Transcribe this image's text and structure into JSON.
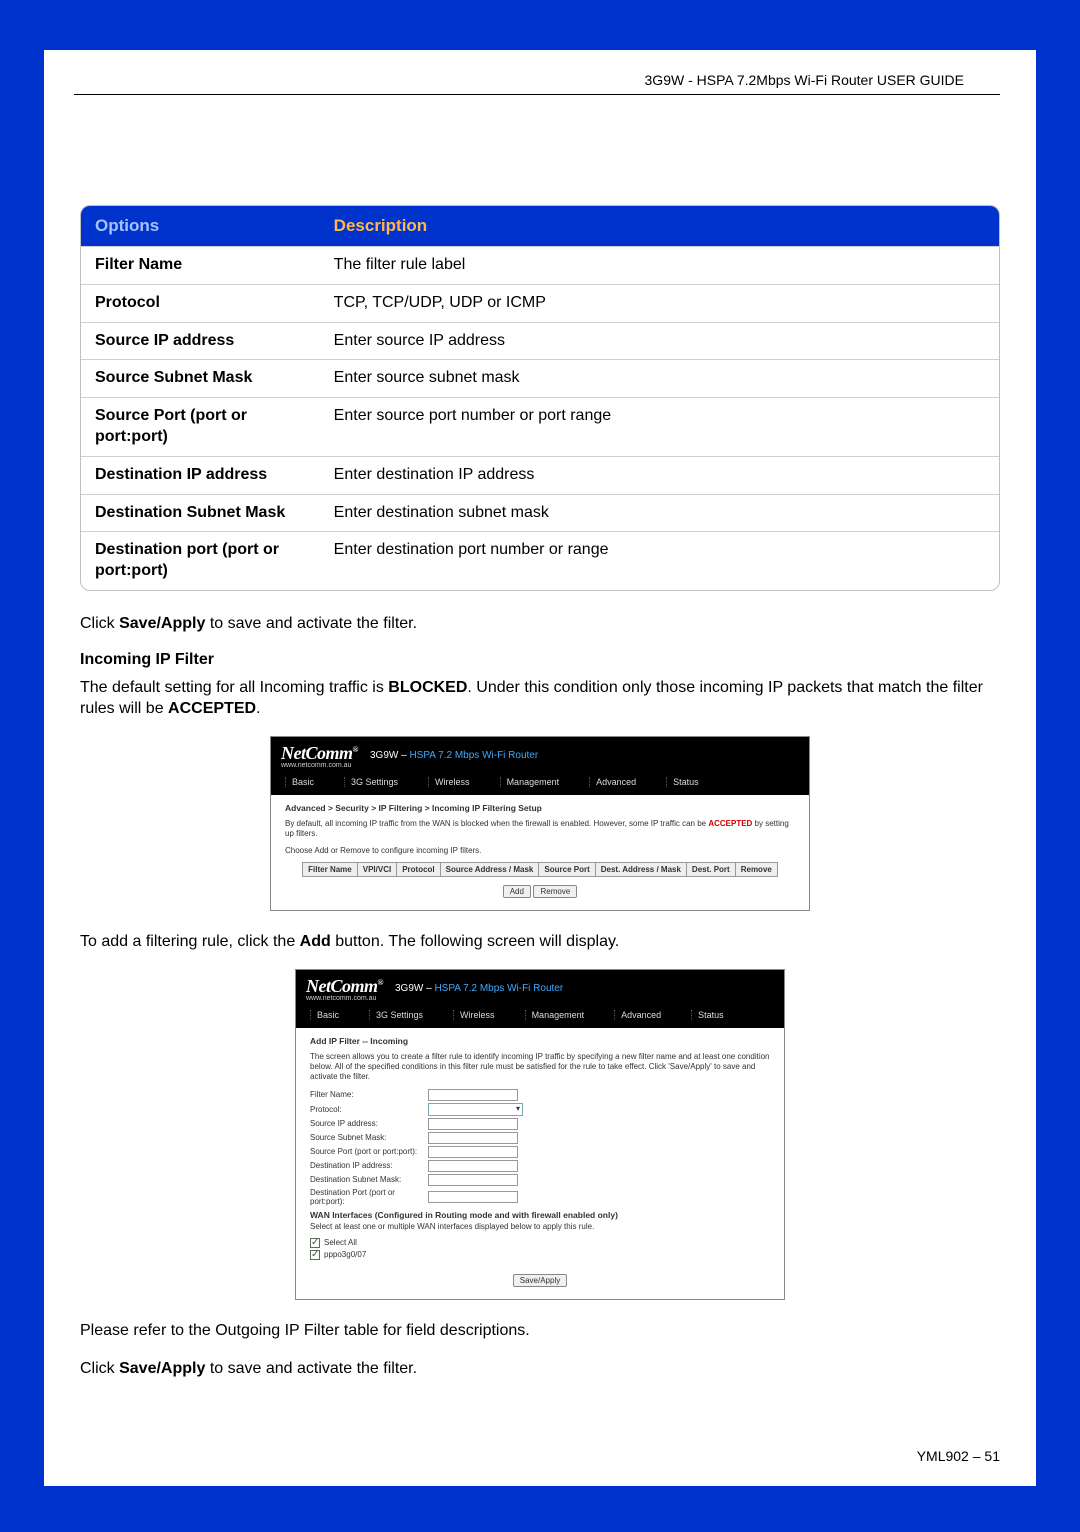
{
  "header": "3G9W - HSPA 7.2Mbps Wi-Fi Router USER GUIDE",
  "table": {
    "head_options": "Options",
    "head_description": "Description",
    "rows": [
      {
        "opt": "Filter Name",
        "desc": "The filter rule label"
      },
      {
        "opt": "Protocol",
        "desc": "TCP, TCP/UDP, UDP or ICMP"
      },
      {
        "opt": "Source IP address",
        "desc": "Enter source IP address"
      },
      {
        "opt": "Source Subnet Mask",
        "desc": "Enter source subnet mask"
      },
      {
        "opt": "Source Port (port or port:port)",
        "desc": "Enter source port number or port range"
      },
      {
        "opt": "Destination IP address",
        "desc": "Enter destination IP address"
      },
      {
        "opt": "Destination Subnet Mask",
        "desc": "Enter destination subnet mask"
      },
      {
        "opt": "Destination port (port or port:port)",
        "desc": "Enter destination port number or range"
      }
    ]
  },
  "para1_pre": "Click ",
  "para1_bold": "Save/Apply",
  "para1_post": " to save and activate the filter.",
  "heading_incoming": "Incoming IP Filter",
  "para2_pre": "The default setting for all Incoming traffic is ",
  "para2_b1": "BLOCKED",
  "para2_mid": ".  Under this condition only those incoming IP packets that match the filter rules will be ",
  "para2_b2": "ACCEPTED",
  "para2_post": ".",
  "shot1": {
    "logo": "NetComm",
    "logo_sub": "www.netcomm.com.au",
    "title_prefix": "3G9W – ",
    "title_hl": "HSPA 7.2 Mbps Wi-Fi Router",
    "nav": [
      "Basic",
      "3G Settings",
      "Wireless",
      "Management",
      "Advanced",
      "Status"
    ],
    "crumb": "Advanced > Security > IP Filtering > Incoming IP Filtering Setup",
    "line1_pre": "By default, all incoming IP traffic from the WAN is blocked when the firewall is enabled. However, some IP traffic can be ",
    "line1_acc": "ACCEPTED",
    "line1_post": " by setting up filters.",
    "line2": "Choose Add or Remove to configure incoming IP filters.",
    "cols": [
      "Filter Name",
      "VPI/VCI",
      "Protocol",
      "Source Address / Mask",
      "Source Port",
      "Dest. Address / Mask",
      "Dest. Port",
      "Remove"
    ],
    "btn_add": "Add",
    "btn_remove": "Remove"
  },
  "para3_pre": "To add a filtering rule, click the ",
  "para3_bold": "Add",
  "para3_post": " button. The following screen will display.",
  "shot2": {
    "crumb": "Add IP Filter -- Incoming",
    "desc": "The screen allows you to create a filter rule to identify incoming IP traffic by specifying a new filter name and at least one condition below. All of the specified conditions in this filter rule must be satisfied for the rule to take effect. Click 'Save/Apply' to save and activate the filter.",
    "labels": {
      "filter_name": "Filter Name:",
      "protocol": "Protocol:",
      "src_ip": "Source IP address:",
      "src_mask": "Source Subnet Mask:",
      "src_port": "Source Port (port or port:port):",
      "dst_ip": "Destination IP address:",
      "dst_mask": "Destination Subnet Mask:",
      "dst_port": "Destination Port (port or port:port):"
    },
    "wan_heading": "WAN Interfaces (Configured in Routing mode and with firewall enabled only)",
    "wan_sub": "Select at least one or multiple WAN interfaces displayed below to apply this rule.",
    "cb1": "Select All",
    "cb2": "pppo3g0/07",
    "btn_save": "Save/Apply"
  },
  "para4": "Please refer to the Outgoing IP Filter table for field descriptions.",
  "para5_pre": "Click ",
  "para5_bold": "Save/Apply",
  "para5_post": " to save and activate the filter.",
  "page_footer": "YML902 – 51"
}
